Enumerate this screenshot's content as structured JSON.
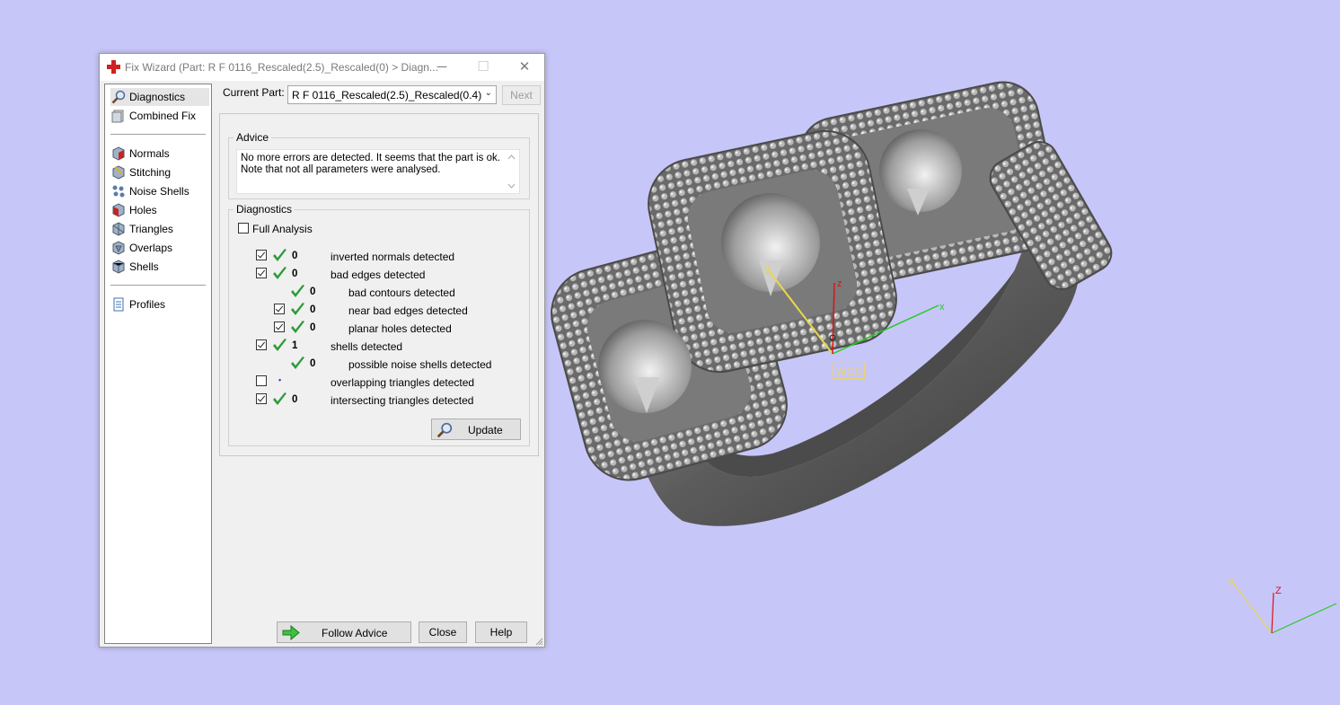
{
  "dialog": {
    "title": "Fix Wizard (Part: R F 0116_Rescaled(2.5)_Rescaled(0) > Diagn...",
    "minimize_glyph": "─",
    "maximize_glyph": "☐",
    "close_glyph": "✕"
  },
  "sidebar": {
    "items": [
      {
        "label": "Diagnostics",
        "icon": "magnifier-icon"
      },
      {
        "label": "Combined Fix",
        "icon": "combined-fix-icon"
      },
      {
        "label": "Normals",
        "icon": "normals-icon"
      },
      {
        "label": "Stitching",
        "icon": "stitching-icon"
      },
      {
        "label": "Noise Shells",
        "icon": "noise-shells-icon"
      },
      {
        "label": "Holes",
        "icon": "holes-icon"
      },
      {
        "label": "Triangles",
        "icon": "triangles-icon"
      },
      {
        "label": "Overlaps",
        "icon": "overlaps-icon"
      },
      {
        "label": "Shells",
        "icon": "shells-icon"
      },
      {
        "label": "Profiles",
        "icon": "profiles-icon"
      }
    ],
    "selected": "Diagnostics"
  },
  "current_part": {
    "label": "Current Part:",
    "value": "R F 0116_Rescaled(2.5)_Rescaled(0.4)",
    "next_label": "Next"
  },
  "advice": {
    "title": "Advice",
    "line1": "No more errors are detected. It seems that the part is ok.",
    "line2": "Note that not all parameters were analysed."
  },
  "diagnostics": {
    "title": "Diagnostics",
    "full_analysis_label": "Full Analysis",
    "full_analysis_checked": false,
    "rows": [
      {
        "checked": true,
        "has_checkbox": true,
        "ok": true,
        "count": "0",
        "label": "inverted normals detected",
        "indent": 0
      },
      {
        "checked": true,
        "has_checkbox": true,
        "ok": true,
        "count": "0",
        "label": "bad edges detected",
        "indent": 0
      },
      {
        "checked": false,
        "has_checkbox": false,
        "ok": true,
        "count": "0",
        "label": "bad contours detected",
        "indent": 1
      },
      {
        "checked": true,
        "has_checkbox": true,
        "ok": true,
        "count": "0",
        "label": "near bad edges detected",
        "indent": 1
      },
      {
        "checked": true,
        "has_checkbox": true,
        "ok": true,
        "count": "0",
        "label": "planar holes detected",
        "indent": 1
      },
      {
        "checked": true,
        "has_checkbox": true,
        "ok": true,
        "count": "1",
        "label": "shells detected",
        "indent": 0
      },
      {
        "checked": false,
        "has_checkbox": false,
        "ok": true,
        "count": "0",
        "label": "possible noise shells detected",
        "indent": 1
      },
      {
        "checked": false,
        "has_checkbox": true,
        "ok": false,
        "count": "•",
        "label": "overlapping triangles detected",
        "indent": 0
      },
      {
        "checked": true,
        "has_checkbox": true,
        "ok": true,
        "count": "0",
        "label": "intersecting triangles detected",
        "indent": 0
      }
    ],
    "update_label": "Update"
  },
  "footer": {
    "follow_advice_label": "Follow Advice",
    "close_label": "Close",
    "help_label": "Help"
  },
  "viewport": {
    "wcs_label": "WCS",
    "axis_x": "x",
    "axis_y": "y",
    "axis_z": "z",
    "corner_axis_y": "Y",
    "corner_axis_z": "Z",
    "background": "#c7c6f8"
  },
  "colors": {
    "ok_tick": "#2f9a3c",
    "axis_x": "#22cc22",
    "axis_y": "#e8d84a",
    "axis_z": "#dd1111"
  }
}
